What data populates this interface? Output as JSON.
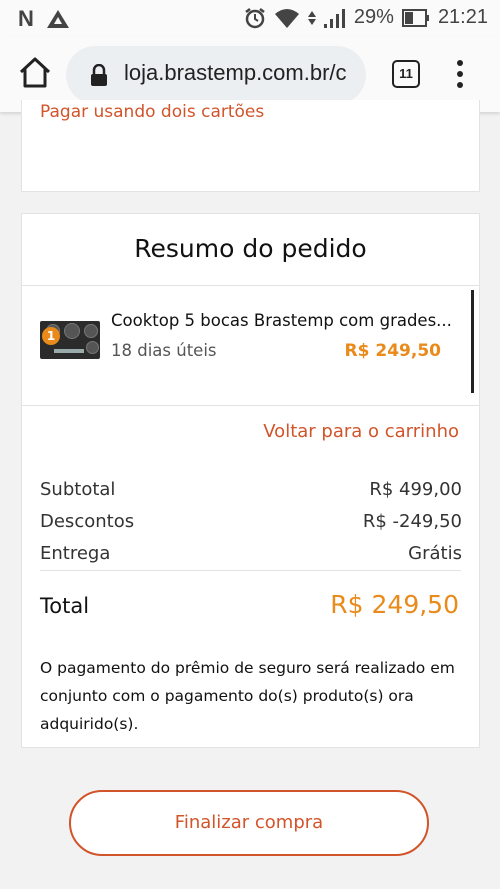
{
  "status_bar": {
    "left_icons": [
      "n-letter-icon",
      "triangle-logo-icon"
    ],
    "battery": "29%",
    "time": "21:21"
  },
  "browser": {
    "url": "loja.brastemp.com.br/c",
    "tab_count": "11"
  },
  "payment": {
    "two_cards_link": "Pagar usando dois cartões"
  },
  "summary": {
    "title": "Resumo do pedido",
    "product": {
      "badge_count": "1",
      "name": "Cooktop 5 bocas Brastemp com grades...",
      "delivery": "18 dias úteis",
      "price": "R$ 249,50"
    },
    "back_link": "Voltar para o carrinho",
    "rows": [
      {
        "label": "Subtotal",
        "value": "R$ 499,00"
      },
      {
        "label": "Descontos",
        "value": "R$ -249,50"
      },
      {
        "label": "Entrega",
        "value": "Grátis"
      }
    ],
    "total_label": "Total",
    "total_value": "R$ 249,50",
    "insurance_note": "O pagamento do prêmio de seguro será realizado em conjunto com o pagamento do(s) produto(s) ora adquirido(s)."
  },
  "checkout": {
    "button_label": "Finalizar compra"
  },
  "colors": {
    "accent_orange": "#e98a1a",
    "link_red": "#d2542a"
  }
}
